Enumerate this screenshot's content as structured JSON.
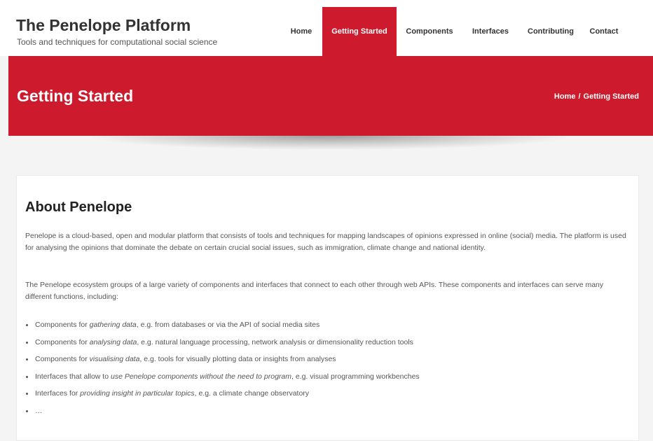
{
  "brand": {
    "title": "The Penelope Platform",
    "tagline": "Tools and techniques for computational social science"
  },
  "nav": {
    "items": [
      {
        "label": "Home"
      },
      {
        "label": "Getting Started",
        "active": true
      },
      {
        "label": "Components"
      },
      {
        "label": "Interfaces"
      },
      {
        "label": "Contributing"
      },
      {
        "label": "Contact"
      }
    ]
  },
  "banner": {
    "title": "Getting Started",
    "breadcrumb": {
      "home": "Home",
      "separator": "/",
      "current": "Getting Started"
    }
  },
  "content": {
    "section_title": "About Penelope",
    "paragraphs": [
      "Penelope is a cloud-based, open and modular platform that consists of tools and techniques for mapping landscapes of opinions expressed in online (social) media. The platform is used for analysing the opinions that dominate the debate on certain crucial social issues, such as immigration, climate change and national identity.",
      "The Penelope ecosystem groups of a large variety of components and interfaces that connect to each other through web APIs. These components and interfaces can serve many different functions, including:"
    ],
    "bullets": [
      {
        "prefix": "Components for ",
        "emphasis": "gathering data",
        "suffix": ", e.g. from databases or via the API of social media sites"
      },
      {
        "prefix": "Components for ",
        "emphasis": "analysing data",
        "suffix": ", e.g. natural language processing, network analysis or dimensionality reduction tools"
      },
      {
        "prefix": "Components for ",
        "emphasis": "visualising data",
        "suffix": ", e.g. tools for visually plotting data or insights from analyses"
      },
      {
        "prefix": "Interfaces that allow to ",
        "emphasis": "use Penelope components without the need to program",
        "suffix": ", e.g. visual programming workbenches"
      },
      {
        "prefix": "Interfaces for ",
        "emphasis": "providing insight in particular topics",
        "suffix": ", e.g. a climate change observatory"
      },
      {
        "prefix": "…",
        "emphasis": "",
        "suffix": ""
      }
    ]
  },
  "colors": {
    "accent": "#cd1a2c",
    "page_background": "#f4f4f4",
    "text": "#555555"
  }
}
